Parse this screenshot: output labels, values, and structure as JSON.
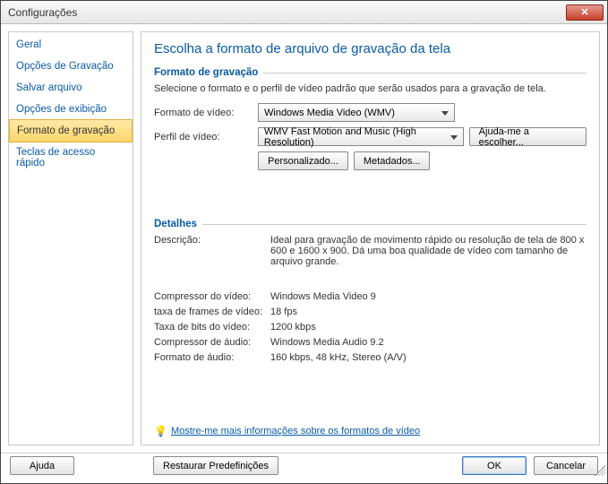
{
  "window": {
    "title": "Configurações"
  },
  "sidebar": {
    "items": [
      {
        "label": "Geral"
      },
      {
        "label": "Opções de Gravação"
      },
      {
        "label": "Salvar arquivo"
      },
      {
        "label": "Opções de exibição"
      },
      {
        "label": "Formato de gravação"
      },
      {
        "label": "Teclas de acesso rápido"
      }
    ]
  },
  "main": {
    "title": "Escolha a formato de arquivo de gravação da tela",
    "group1": "Formato de gravação",
    "instruction": "Selecione o formato e o perfil de vídeo padrão que serão usados para a gravação de tela.",
    "video_format_label": "Formato de vídeo:",
    "video_format_value": "Windows Media Video (WMV)",
    "video_profile_label": "Perfil de vídeo:",
    "video_profile_value": "WMV Fast Motion and Music (High Resolution)",
    "help_choose": "Ajuda-me a escolher...",
    "custom_btn": "Personalizado...",
    "metadata_btn": "Metadados...",
    "group2": "Detalhes",
    "desc_label": "Descrição:",
    "desc_value": "Ideal para gravação de movimento rápido ou resolução de tela de 800 x 600 e 1600 x 900. Dá uma boa qualidade de vídeo com tamanho de arquivo grande.",
    "compressor_v_label": "Compressor do vídeo:",
    "compressor_v_value": "Windows Media Video 9",
    "fps_label": "taxa de frames de vídeo:",
    "fps_value": "18 fps",
    "bitrate_v_label": "Taxa de bits do vídeo:",
    "bitrate_v_value": "1200 kbps",
    "compressor_a_label": "Compressor de áudio:",
    "compressor_a_value": "Windows Media Audio 9.2",
    "audio_format_label": "Formato de áudio:",
    "audio_format_value": "160 kbps, 48 kHz, Stereo (A/V)",
    "more_info_link": "Mostre-me mais informações sobre os formatos de vídeo"
  },
  "footer": {
    "help": "Ajuda",
    "restore": "Restaurar Predefinições",
    "ok": "OK",
    "cancel": "Cancelar"
  }
}
